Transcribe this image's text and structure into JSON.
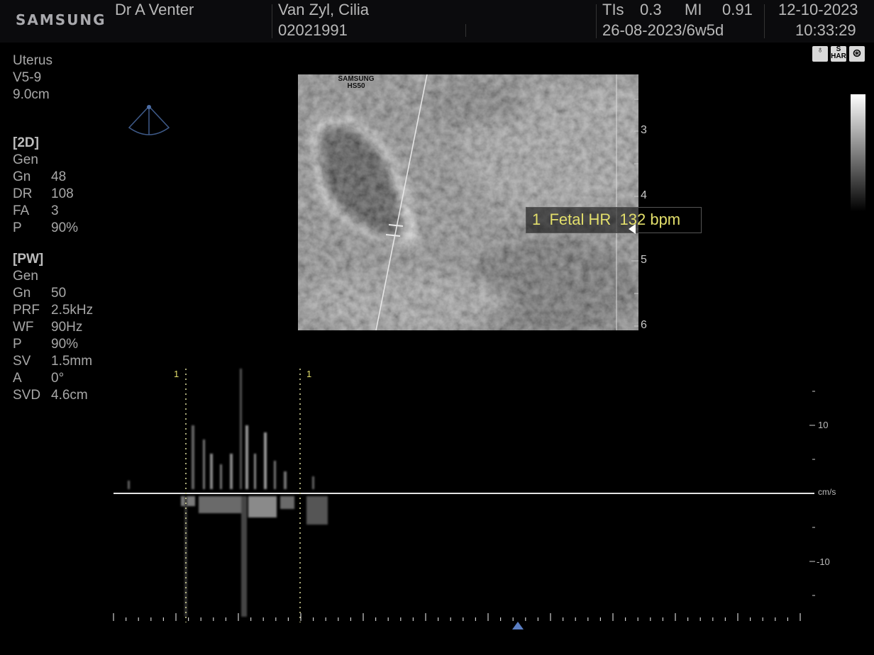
{
  "header": {
    "brand": "SAMSUNG",
    "operator": "Dr A Venter",
    "patient_name": "Van Zyl, Cilia",
    "patient_id": "02021991",
    "tis_label": "TIs",
    "tis_value": "0.3",
    "mi_label": "MI",
    "mi_value": "0.91",
    "lmp_ga": "26-08-2023/6w5d",
    "date": "12-10-2023",
    "time": "10:33:29"
  },
  "probe": {
    "preset": "Uterus",
    "transducer": "V5-9",
    "depth": "9.0cm"
  },
  "params_2d": {
    "title": "[2D]",
    "mode": "Gen",
    "rows": [
      {
        "k": "Gn",
        "v": "48"
      },
      {
        "k": "DR",
        "v": "108"
      },
      {
        "k": "FA",
        "v": "3"
      },
      {
        "k": "P",
        "v": "90%"
      }
    ]
  },
  "params_pw": {
    "title": "[PW]",
    "mode": "Gen",
    "rows": [
      {
        "k": "Gn",
        "v": "50"
      },
      {
        "k": "PRF",
        "v": "2.5kHz"
      },
      {
        "k": "WF",
        "v": "90Hz"
      },
      {
        "k": "P",
        "v": "90%"
      },
      {
        "k": "SV",
        "v": "1.5mm"
      },
      {
        "k": "A",
        "v": "0°"
      },
      {
        "k": "SVD",
        "v": "4.6cm"
      }
    ]
  },
  "image_watermark": {
    "line1": "SAMSUNG",
    "line2": "HS50"
  },
  "depth_scale": {
    "labels": [
      "3",
      "4",
      "5",
      "6"
    ]
  },
  "measurement": {
    "index": "1",
    "label": "Fetal HR",
    "value": "132 bpm"
  },
  "top_icons": [
    {
      "name": "fetal-icon",
      "glyph": "♁"
    },
    {
      "name": "s-har-icon",
      "glyph": "S HAR"
    },
    {
      "name": "settings-wheel-icon",
      "glyph": "⊛"
    }
  ],
  "doppler": {
    "unit": "cm/s",
    "scale_labels": [
      "10",
      "-10"
    ],
    "caliper_labels": [
      "1",
      "1"
    ]
  }
}
